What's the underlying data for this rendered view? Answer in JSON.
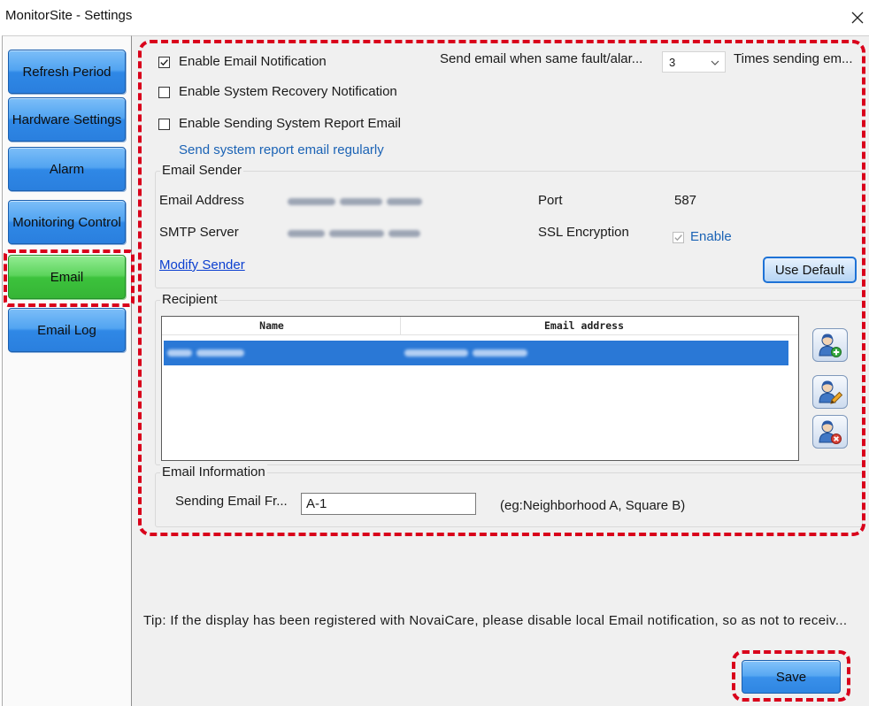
{
  "window": {
    "title": "MonitorSite - Settings",
    "close_icon": "close-icon"
  },
  "sidebar": {
    "items": [
      {
        "label": "Refresh Period",
        "active": false
      },
      {
        "label": "Hardware Settings",
        "active": false
      },
      {
        "label": "Alarm",
        "active": false
      },
      {
        "label": "Monitoring Control",
        "active": false
      },
      {
        "label": "Email",
        "active": true
      },
      {
        "label": "Email Log",
        "active": false
      }
    ]
  },
  "notifications": {
    "enable_email": {
      "label": "Enable Email Notification",
      "checked": true
    },
    "repeat_prefix": "Send email when same fault/alar...",
    "repeat_count": "3",
    "repeat_suffix": "Times sending em...",
    "enable_recovery": {
      "label": "Enable System Recovery Notification",
      "checked": false
    },
    "enable_report": {
      "label": "Enable Sending System Report Email",
      "checked": false
    },
    "report_link": "Send system report email regularly"
  },
  "email_sender": {
    "legend": "Email Sender",
    "address_label": "Email Address",
    "smtp_label": "SMTP Server",
    "port_label": "Port",
    "port_value": "587",
    "ssl_label": "SSL Encryption",
    "ssl_enable_label": "Enable",
    "ssl_enabled": true,
    "ssl_disabled_control": true,
    "modify_link": "Modify Sender",
    "use_default_button": "Use Default"
  },
  "recipient": {
    "legend": "Recipient",
    "columns": [
      "Name",
      "Email address"
    ],
    "rows": [
      {
        "selected": true
      }
    ],
    "actions": [
      {
        "icon": "add-recipient-icon"
      },
      {
        "icon": "edit-recipient-icon"
      },
      {
        "icon": "delete-recipient-icon"
      }
    ]
  },
  "email_info": {
    "legend": "Email Information",
    "sending_from_label": "Sending Email Fr...",
    "sending_from_value": "A-1",
    "example": "(eg:Neighborhood A, Square B)"
  },
  "tip": "Tip: If the display has been registered with NovaiCare, please disable local Email notification, so as not to receiv...",
  "footer": {
    "save_button": "Save"
  },
  "colors": {
    "nav_blue": "#2f88e6",
    "nav_active_green": "#3cc23c",
    "selected_row_blue": "#2a78d6",
    "link_blue": "#1b63b5",
    "annotation_red": "#d9001b"
  }
}
